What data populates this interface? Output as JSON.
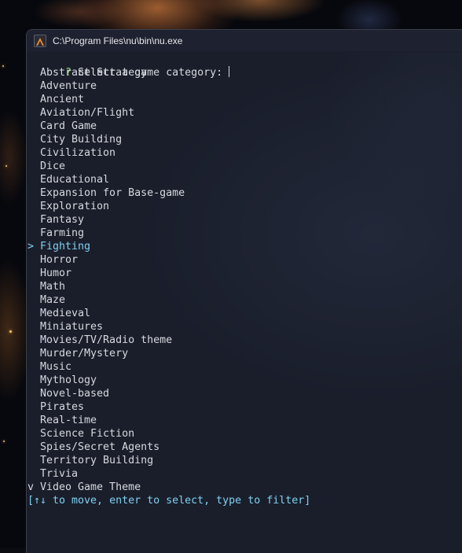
{
  "window": {
    "title": "C:\\Program Files\\nu\\bin\\nu.exe"
  },
  "prompt": {
    "marker": "?",
    "question": "Select a game category:"
  },
  "options": [
    "Abstract Strategy",
    "Adventure",
    "Ancient",
    "Aviation/Flight",
    "Card Game",
    "City Building",
    "Civilization",
    "Dice",
    "Educational",
    "Expansion for Base-game",
    "Exploration",
    "Fantasy",
    "Farming",
    "Fighting",
    "Horror",
    "Humor",
    "Math",
    "Maze",
    "Medieval",
    "Miniatures",
    "Movies/TV/Radio theme",
    "Murder/Mystery",
    "Music",
    "Mythology",
    "Novel-based",
    "Pirates",
    "Real-time",
    "Science Fiction",
    "Spies/Secret Agents",
    "Territory Building",
    "Trivia",
    "Video Game Theme"
  ],
  "selected_option": "Fighting",
  "selection_marker": ">",
  "more_marker": "v",
  "help_text": "[↑↓ to move, enter to select, type to filter]",
  "colors": {
    "prompt_marker": "#8fd45f",
    "selected": "#7fd0f0",
    "help": "#7fd0f0",
    "text": "#d6d9de",
    "terminal_bg": "#1a1e2b"
  },
  "icons": {
    "app": "nushell-icon"
  }
}
